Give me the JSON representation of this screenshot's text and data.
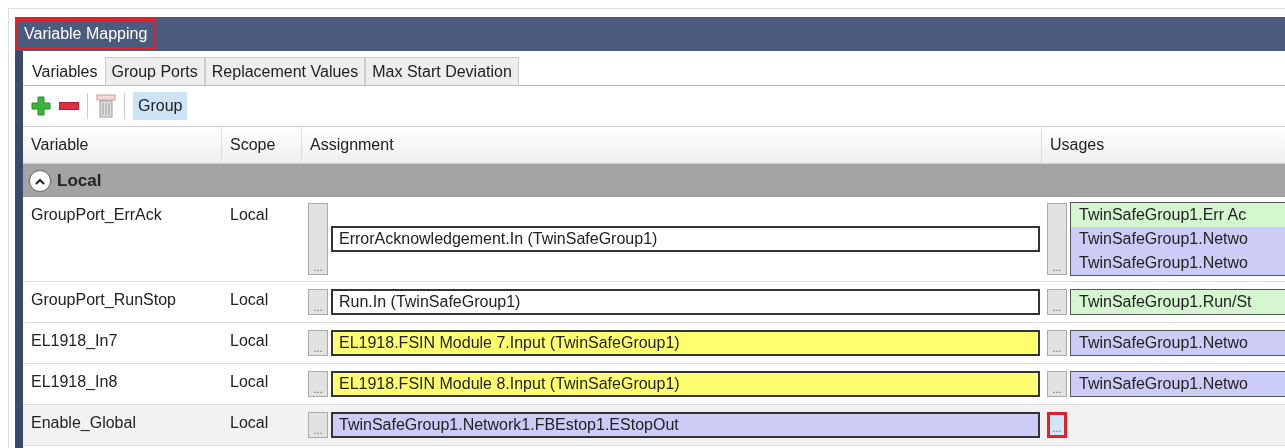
{
  "window": {
    "title": "Variable Mapping",
    "title_highlighted": true
  },
  "tabs": [
    {
      "label": "Variables",
      "selected": true
    },
    {
      "label": "Group Ports",
      "selected": false
    },
    {
      "label": "Replacement Values",
      "selected": false
    },
    {
      "label": "Max Start Deviation",
      "selected": false
    }
  ],
  "toolbar": {
    "group_button": {
      "label": "Group",
      "selected": true
    }
  },
  "table": {
    "columns": [
      "Variable",
      "Scope",
      "Assignment",
      "Usages"
    ],
    "groups": [
      {
        "label": "Local",
        "expanded": true,
        "rows": [
          {
            "variable": "GroupPort_ErrAck",
            "scope": "Local",
            "assign_button": "...",
            "assignment": {
              "text": "ErrorAcknowledgement.In (TwinSafeGroup1)",
              "color": "#ffffff"
            },
            "usages_button": "...",
            "usages_highlighted": false,
            "usages": [
              {
                "text": "TwinSafeGroup1.Err Ac",
                "color": "#d4f7d0"
              },
              {
                "text": "TwinSafeGroup1.Netwo",
                "color": "#ccccf7"
              },
              {
                "text": "TwinSafeGroup1.Netwo",
                "color": "#ccccf7"
              }
            ],
            "selected": false
          },
          {
            "variable": "GroupPort_RunStop",
            "scope": "Local",
            "assign_button": "...",
            "assignment": {
              "text": "Run.In (TwinSafeGroup1)",
              "color": "#ffffff"
            },
            "usages_button": "...",
            "usages_highlighted": false,
            "usages": [
              {
                "text": "TwinSafeGroup1.Run/St",
                "color": "#d4f7d0"
              }
            ],
            "selected": false
          },
          {
            "variable": "EL1918_In7",
            "scope": "Local",
            "assign_button": "...",
            "assignment": {
              "text": "EL1918.FSIN Module 7.Input (TwinSafeGroup1)",
              "color": "#ffff70"
            },
            "usages_button": "...",
            "usages_highlighted": false,
            "usages": [
              {
                "text": "TwinSafeGroup1.Netwo",
                "color": "#ccccf7"
              }
            ],
            "selected": false
          },
          {
            "variable": "EL1918_In8",
            "scope": "Local",
            "assign_button": "...",
            "assignment": {
              "text": "EL1918.FSIN Module 8.Input (TwinSafeGroup1)",
              "color": "#ffff70"
            },
            "usages_button": "...",
            "usages_highlighted": false,
            "usages": [
              {
                "text": "TwinSafeGroup1.Netwo",
                "color": "#ccccf7"
              }
            ],
            "selected": false
          },
          {
            "variable": "Enable_Global",
            "scope": "Local",
            "assign_button": "...",
            "assignment": {
              "text": "TwinSafeGroup1.Network1.FBEstop1.EStopOut",
              "color": "#ccccf7"
            },
            "usages_button": "...",
            "usages_highlighted": true,
            "usages": [],
            "selected": true
          }
        ]
      }
    ]
  }
}
